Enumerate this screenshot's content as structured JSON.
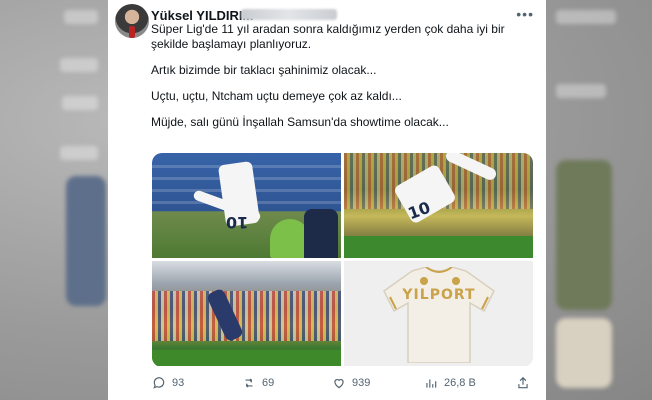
{
  "tweet": {
    "author_name": "Yüksel YILDIRIM",
    "more_icon": "more-horizontal-icon",
    "lines": [
      "Süper Lig'de 11 yıl aradan sonra kaldığımız yerden çok daha iyi bir şekilde başlamayı planlıyoruz.",
      "Artık bizimde bir taklacı şahinimiz olacak...",
      "Uçtu, uçtu, Ntcham uçtu demeye çok az kaldı...",
      "Müjde, salı günü İnşallah Samsun'da showtime olacak..."
    ],
    "images": [
      {
        "number": "10"
      },
      {
        "number": "10"
      },
      {},
      {
        "jersey_text": "YILPORT"
      }
    ],
    "actions": {
      "replies": "93",
      "retweets": "69",
      "likes": "939",
      "views": "26,8 B"
    }
  },
  "colors": {
    "text": "#0f1419",
    "secondary": "#536471",
    "card_bg": "#ffffff"
  }
}
